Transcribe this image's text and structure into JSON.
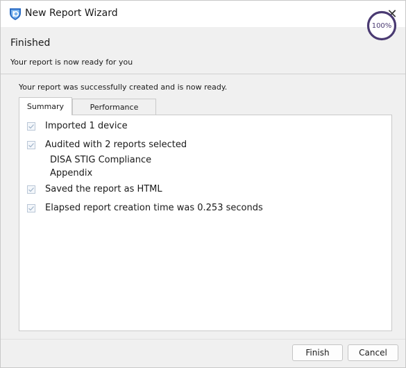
{
  "window": {
    "title": "New Report Wizard",
    "close_symbol": "✕"
  },
  "header": {
    "title": "Finished",
    "subtitle": "Your report is now ready for you",
    "progress_label": "100%",
    "progress_fraction": 1.0,
    "progress_color": "#4a3a72"
  },
  "content": {
    "status_text": "Your report was successfully created and is now ready.",
    "tabs": [
      {
        "label": "Summary",
        "selected": true
      },
      {
        "label": "Performance",
        "selected": false
      }
    ],
    "summary_items": [
      {
        "label": "Imported 1 device",
        "checked": true
      },
      {
        "label": "Audited with 2 reports selected",
        "checked": true,
        "sub_items": [
          "DISA STIG Compliance",
          "Appendix"
        ]
      },
      {
        "label": "Saved the report as HTML",
        "checked": true
      },
      {
        "label": "Elapsed report creation time was 0.253 seconds",
        "checked": true
      }
    ]
  },
  "footer": {
    "finish_label": "Finish",
    "cancel_label": "Cancel"
  },
  "icons": {
    "app": "shield-report-icon",
    "close": "close-icon",
    "check": "checkmark-icon"
  }
}
